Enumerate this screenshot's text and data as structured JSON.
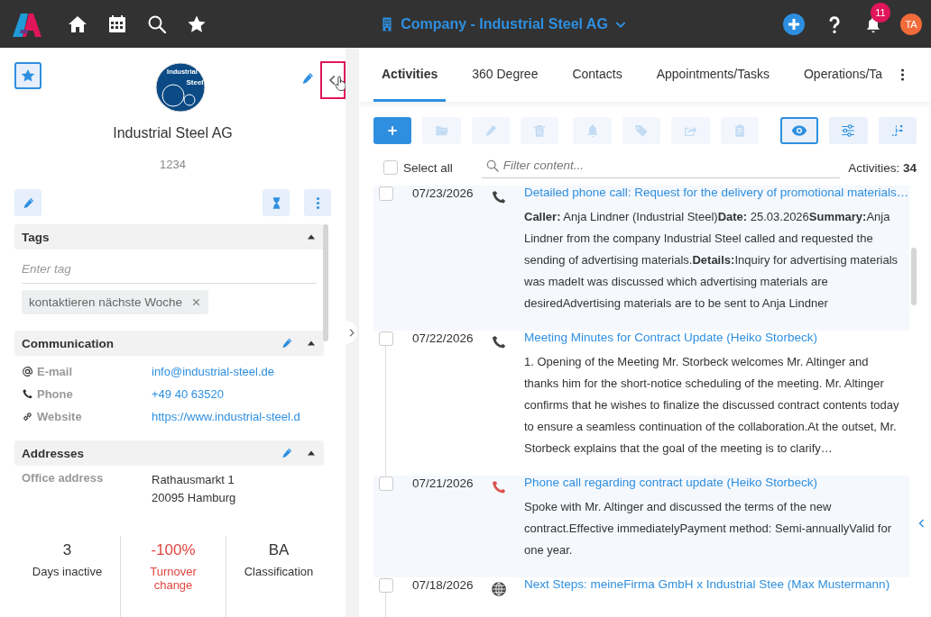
{
  "topbar": {
    "title": "Company - Industrial Steel AG",
    "notifications": "11",
    "avatar": "TA"
  },
  "company": {
    "favorite": true,
    "logo_lines": [
      "Industrial",
      "Steel"
    ],
    "name": "Industrial Steel AG",
    "number": "1234",
    "collapse_highlighted": true
  },
  "tags": {
    "title": "Tags",
    "expanded": true,
    "placeholder": "Enter tag",
    "chips": [
      "kontaktieren nächste Woche"
    ]
  },
  "communication": {
    "title": "Communication",
    "expanded": true,
    "rows": [
      {
        "kind": "email",
        "label": "E-mail",
        "value": "info@industrial-steel.de"
      },
      {
        "kind": "phone",
        "label": "Phone",
        "value": "+49 40 63520"
      },
      {
        "kind": "link",
        "label": "Website",
        "value": "https://www.industrial-steel.d"
      }
    ]
  },
  "addresses": {
    "title": "Addresses",
    "expanded": true,
    "rows": [
      {
        "label": "Office address",
        "lines": [
          "Rathausmarkt 1",
          "20095 Hamburg"
        ]
      }
    ]
  },
  "stats": [
    {
      "value": "3",
      "label": "Days inactive",
      "negative": false
    },
    {
      "value": "-100%",
      "label": "Turnover change",
      "negative": true
    },
    {
      "value": "BA",
      "label": "Classification",
      "negative": false
    }
  ],
  "tabs": [
    {
      "label": "Activities",
      "selected": true
    },
    {
      "label": "360 Degree",
      "selected": false
    },
    {
      "label": "Contacts",
      "selected": false
    },
    {
      "label": "Appointments/Tasks",
      "selected": false
    },
    {
      "label": "Operations/Ta",
      "selected": false
    }
  ],
  "toolbar": [
    {
      "kind": "add",
      "disabled": false
    },
    {
      "kind": "folder",
      "disabled": true
    },
    {
      "kind": "edit",
      "disabled": true
    },
    {
      "kind": "delete",
      "disabled": true
    },
    {
      "kind": "bell",
      "disabled": true
    },
    {
      "kind": "tag",
      "disabled": true
    },
    {
      "kind": "export",
      "disabled": true
    },
    {
      "kind": "clipboard",
      "disabled": true
    }
  ],
  "view_tools": [
    {
      "kind": "eye",
      "selected": true
    },
    {
      "kind": "sliders",
      "selected": false
    },
    {
      "kind": "tree",
      "selected": false
    }
  ],
  "select_all": {
    "label": "Select all",
    "checked": false
  },
  "filter": {
    "placeholder": "Filter content..."
  },
  "count": {
    "label": "Activities:",
    "value": "34"
  },
  "activities": [
    {
      "date": "07/23/2026",
      "kind": "phone",
      "color": "#444444",
      "checked": false,
      "title": "Detailed phone call: Request for the delivery of promotional materials…",
      "body": "**Caller:** Anja Lindner (Industrial Steel)**Date:** 25.03.2026**Summary:**Anja Lindner from the company Industrial Steel called and requested the sending of advertising materials.**Details:**Inquiry for advertising materials was madeIt was discussed which advertising materials are desiredAdvertising materials are to be sent to Anja Lindner"
    },
    {
      "date": "07/22/2026",
      "kind": "phone",
      "color": "#444444",
      "checked": false,
      "title": "Meeting Minutes for Contract Update (Heiko Storbeck)",
      "body": "1. Opening of the Meeting Mr. Storbeck welcomes Mr. Altinger and thanks him for the short-notice scheduling of the meeting. Mr. Altinger confirms that he wishes to finalize the discussed contract contents today to ensure a seamless continuation of the collaboration.At the outset, Mr. Storbeck explains that the goal of the meeting is to clarify…"
    },
    {
      "date": "07/21/2026",
      "kind": "phone",
      "color": "#d9534f",
      "checked": false,
      "title": "Phone call regarding contract update (Heiko Storbeck)",
      "body": "Spoke with Mr. Altinger and discussed the terms of the new contract.Effective immediatelyPayment method: Semi-annuallyValid for one year."
    },
    {
      "date": "07/18/2026",
      "kind": "web",
      "color": "#444444",
      "checked": false,
      "title": "Next Steps: meineFirma GmbH x Industrial Stee (Max Mustermann)"
    }
  ]
}
